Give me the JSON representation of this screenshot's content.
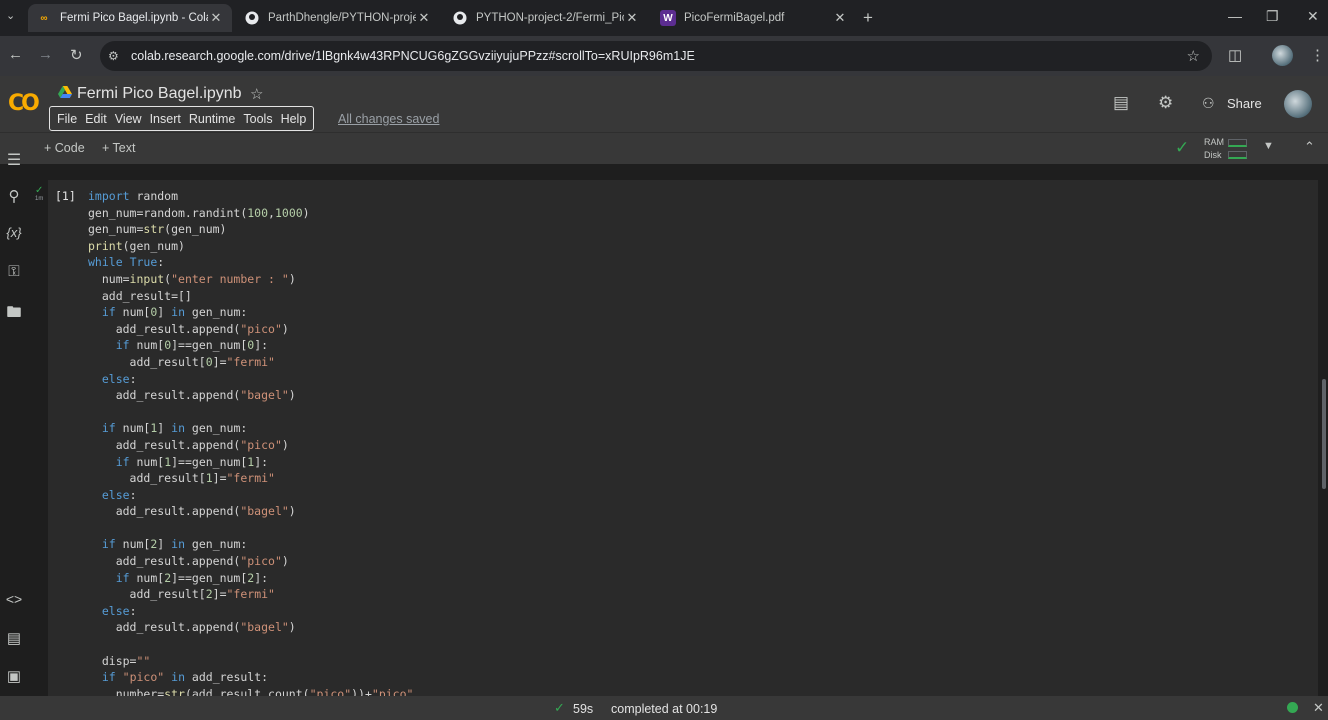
{
  "browser": {
    "tabs": [
      {
        "title": "Fermi Pico Bagel.ipynb - Colab",
        "favicon": "colab-icon",
        "active": true
      },
      {
        "title": "ParthDhengle/PYTHON-project",
        "favicon": "github-icon",
        "active": false
      },
      {
        "title": "PYTHON-project-2/Fermi_Pico_",
        "favicon": "github-icon",
        "active": false
      },
      {
        "title": "PicoFermiBagel.pdf",
        "favicon": "W",
        "active": false
      }
    ],
    "url": "colab.research.google.com/drive/1lBgnk4w43RPNCUG6gZGGvziiyujuPPzz#scrollTo=xRUIpR96m1JE"
  },
  "colab": {
    "logo": "CO",
    "notebook_title": "Fermi Pico Bagel.ipynb",
    "menu": [
      "File",
      "Edit",
      "View",
      "Insert",
      "Runtime",
      "Tools",
      "Help"
    ],
    "save_status": "All changes saved",
    "share_label": "Share"
  },
  "toolbar": {
    "add_code": "+ Code",
    "add_text": "+ Text",
    "ram_label": "RAM",
    "disk_label": "Disk"
  },
  "cell": {
    "exec_count": "[1]",
    "status_time": "1m",
    "code_lines": [
      "import random",
      "gen_num=random.randint(100,1000)",
      "gen_num=str(gen_num)",
      "print(gen_num)",
      "while True:",
      "  num=input(\"enter number : \")",
      "  add_result=[]",
      "  if num[0] in gen_num:",
      "    add_result.append(\"pico\")",
      "    if num[0]==gen_num[0]:",
      "      add_result[0]=\"fermi\"",
      "  else:",
      "    add_result.append(\"bagel\")",
      "",
      "  if num[1] in gen_num:",
      "    add_result.append(\"pico\")",
      "    if num[1]==gen_num[1]:",
      "      add_result[1]=\"fermi\"",
      "  else:",
      "    add_result.append(\"bagel\")",
      "",
      "  if num[2] in gen_num:",
      "    add_result.append(\"pico\")",
      "    if num[2]==gen_num[2]:",
      "      add_result[2]=\"fermi\"",
      "  else:",
      "    add_result.append(\"bagel\")",
      "",
      "  disp=\"\"",
      "  if \"pico\" in add_result:",
      "    number=str(add_result.count(\"pico\"))+\"pico\""
    ]
  },
  "statusbar": {
    "duration": "59s",
    "completed": "completed at 00:19"
  },
  "colors": {
    "accent_green": "#34a853",
    "logo_orange": "#f9ab00",
    "keyword_blue": "#569cd6",
    "string_orange": "#ce9178"
  }
}
